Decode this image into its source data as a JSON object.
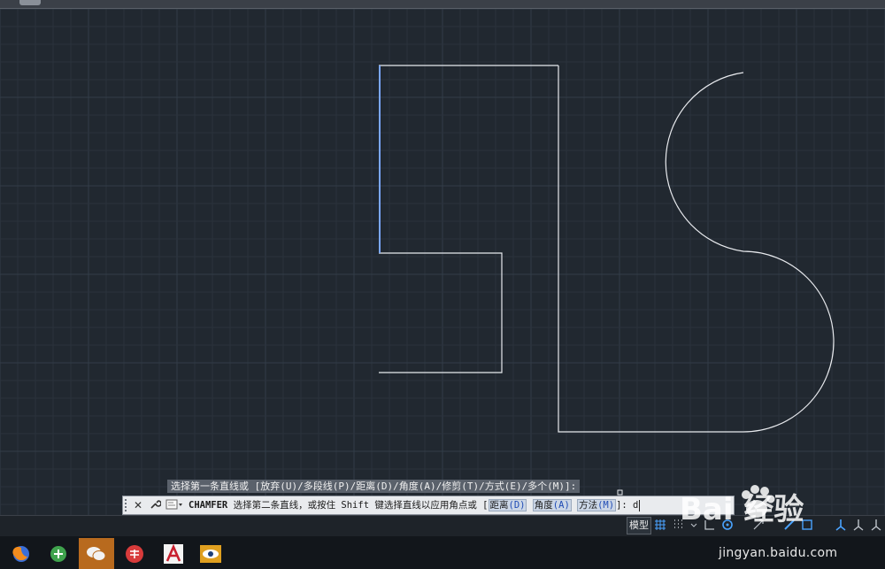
{
  "command_history": "选择第一条直线或 [放弃(U)/多段线(P)/距离(D)/角度(A)/修剪(T)/方式(E)/多个(M)]:",
  "command_line": {
    "name": "CHAMFER",
    "prompt": "选择第二条直线，或按住 Shift 键选择直线以应用角点或 [",
    "options": [
      {
        "label": "距离",
        "key": "(D)"
      },
      {
        "label": "角度",
        "key": "(A)"
      },
      {
        "label": "方法",
        "key": "(M)"
      }
    ],
    "suffix": "]:",
    "input_value": "d"
  },
  "status": {
    "model_tab": "模型"
  },
  "taskbar": {
    "apps": [
      "firefox-icon",
      "browser-icon",
      "wechat-icon",
      "app-icon",
      "autocad-icon",
      "viewer-icon"
    ]
  },
  "watermark": {
    "logo": "Bai 经验",
    "url": "jingyan.baidu.com"
  },
  "colors": {
    "canvas_bg": "#212830",
    "grid_minor": "#2a323c",
    "grid_major": "#333d48",
    "line": "#e8eaee",
    "selected": "#7aa7ff",
    "taskbar_active": "#b86a1e"
  }
}
